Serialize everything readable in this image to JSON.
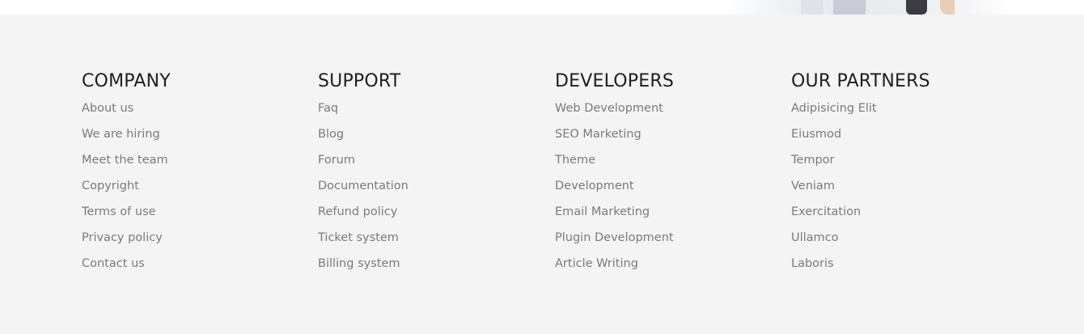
{
  "footer": {
    "columns": [
      {
        "heading": "COMPANY",
        "links": [
          "About us",
          "We are hiring",
          "Meet the team",
          "Copyright",
          "Terms of use",
          "Privacy policy",
          "Contact us"
        ]
      },
      {
        "heading": "SUPPORT",
        "links": [
          "Faq",
          "Blog",
          "Forum",
          "Documentation",
          "Refund policy",
          "Ticket system",
          "Billing system"
        ]
      },
      {
        "heading": "DEVELOPERS",
        "links": [
          "Web Development",
          "SEO Marketing",
          "Theme",
          "Development",
          "Email Marketing",
          "Plugin Development",
          "Article Writing"
        ]
      },
      {
        "heading": "OUR PARTNERS",
        "links": [
          "Adipisicing Elit",
          "Eiusmod",
          "Tempor",
          "Veniam",
          "Exercitation",
          "Ullamco",
          "Laboris"
        ]
      }
    ]
  }
}
